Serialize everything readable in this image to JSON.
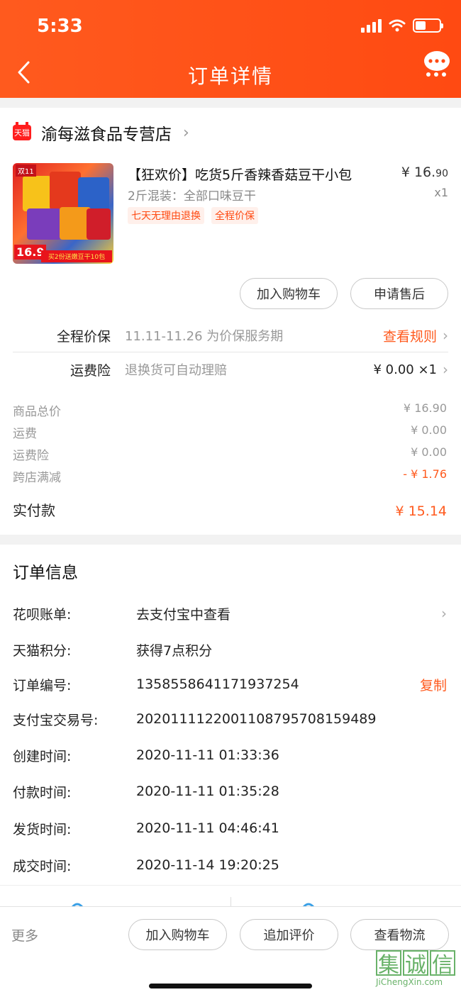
{
  "status_bar": {
    "time": "5:33"
  },
  "header": {
    "title": "订单详情"
  },
  "store": {
    "badge": "天猫",
    "name": "渝每滋食品专营店"
  },
  "product": {
    "image_badge": "双11",
    "image_price": "16.9",
    "image_banner": "买2份送嫩豆干10包",
    "title": "【狂欢价】吃货5斤香辣香菇豆干小包",
    "sku": "2斤混装：全部口味豆干",
    "price_main": "¥ 16.",
    "price_cents": "90",
    "qty": "x1",
    "tags": [
      "七天无理由退换",
      "全程价保"
    ]
  },
  "item_actions": {
    "add_cart": "加入购物车",
    "after_sale": "申请售后"
  },
  "services": [
    {
      "label": "全程价保",
      "desc": "11.11-11.26 为价保服务期",
      "right": "查看规则"
    },
    {
      "label": "运费险",
      "desc": "退换货可自动理赔",
      "right": "¥ 0.00 ×1"
    }
  ],
  "summary": [
    {
      "label": "商品总价",
      "value": "¥ 16.90"
    },
    {
      "label": "运费",
      "value": "¥ 0.00"
    },
    {
      "label": "运费险",
      "value": "¥ 0.00"
    },
    {
      "label": "跨店满减",
      "value": "- ¥ 1.76"
    }
  ],
  "total": {
    "label": "实付款",
    "value": "¥ 15.14"
  },
  "order_info": {
    "title": "订单信息",
    "rows": [
      {
        "label": "花呗账单:",
        "value": "去支付宝中查看"
      },
      {
        "label": "天猫积分:",
        "value": "获得7点积分"
      },
      {
        "label": "订单编号:",
        "value": "1358558641171937254",
        "action": "复制"
      },
      {
        "label": "支付宝交易号:",
        "value": "2020111122001108795708159489"
      },
      {
        "label": "创建时间:",
        "value": "2020-11-11 01:33:36"
      },
      {
        "label": "付款时间:",
        "value": "2020-11-11 01:35:28"
      },
      {
        "label": "发货时间:",
        "value": "2020-11-11 04:46:41"
      },
      {
        "label": "成交时间:",
        "value": "2020-11-14 19:20:25"
      }
    ]
  },
  "bottom_bar": {
    "more": "更多",
    "buttons": [
      "加入购物车",
      "追加评价",
      "查看物流"
    ]
  },
  "watermark": {
    "chars": [
      "集",
      "诚",
      "信"
    ],
    "url": "JiChengXin.com"
  },
  "colors": {
    "accent": "#ff4a12",
    "background": "#f2f2f2"
  }
}
